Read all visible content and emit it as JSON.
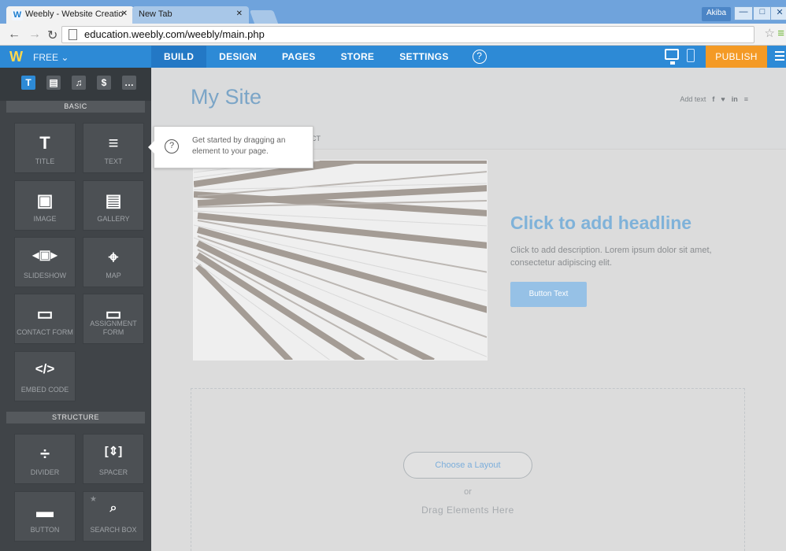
{
  "browser": {
    "active_tab": "Weebly - Website Creatio",
    "inactive_tab": "New Tab",
    "url": "education.weebly.com/weebly/main.php",
    "user": "Akiba"
  },
  "weebly": {
    "plan": "FREE",
    "nav": [
      "BUILD",
      "DESIGN",
      "PAGES",
      "STORE",
      "SETTINGS"
    ],
    "publish": "PUBLISH"
  },
  "sidebar": {
    "basic_heading": "BASIC",
    "structure_heading": "STRUCTURE",
    "basic": [
      {
        "glyph": "T",
        "label": "TITLE"
      },
      {
        "glyph": "≡",
        "label": "TEXT"
      },
      {
        "glyph": "▣",
        "label": "IMAGE"
      },
      {
        "glyph": "▤",
        "label": "GALLERY"
      },
      {
        "glyph": "◂▣▸",
        "label": "SLIDESHOW"
      },
      {
        "glyph": "⌖",
        "label": "MAP"
      },
      {
        "glyph": "▭",
        "label": "CONTACT FORM"
      },
      {
        "glyph": "▭",
        "label": "ASSIGNMENT FORM"
      },
      {
        "glyph": "</>",
        "label": "EMBED CODE"
      }
    ],
    "structure": [
      {
        "glyph": "÷",
        "label": "DIVIDER"
      },
      {
        "glyph": "[⇕]",
        "label": "SPACER"
      },
      {
        "glyph": "▬",
        "label": "BUTTON"
      },
      {
        "glyph": "⌕",
        "label": "SEARCH BOX"
      }
    ]
  },
  "tooltip": {
    "text": "Get started by dragging an element to your page."
  },
  "site": {
    "title": "My Site",
    "header_text": "Add text",
    "menu_fragment": "CT",
    "headline": "Click to add headline",
    "description": "Click to add description. Lorem ipsum dolor sit amet, consectetur adipiscing elit.",
    "button": "Button Text",
    "layout_button": "Choose a Layout",
    "or": "or",
    "drag": "Drag Elements Here"
  },
  "colors": {
    "accent": "#2d8ad6",
    "publish": "#f49a25",
    "sidebar": "#404448"
  }
}
